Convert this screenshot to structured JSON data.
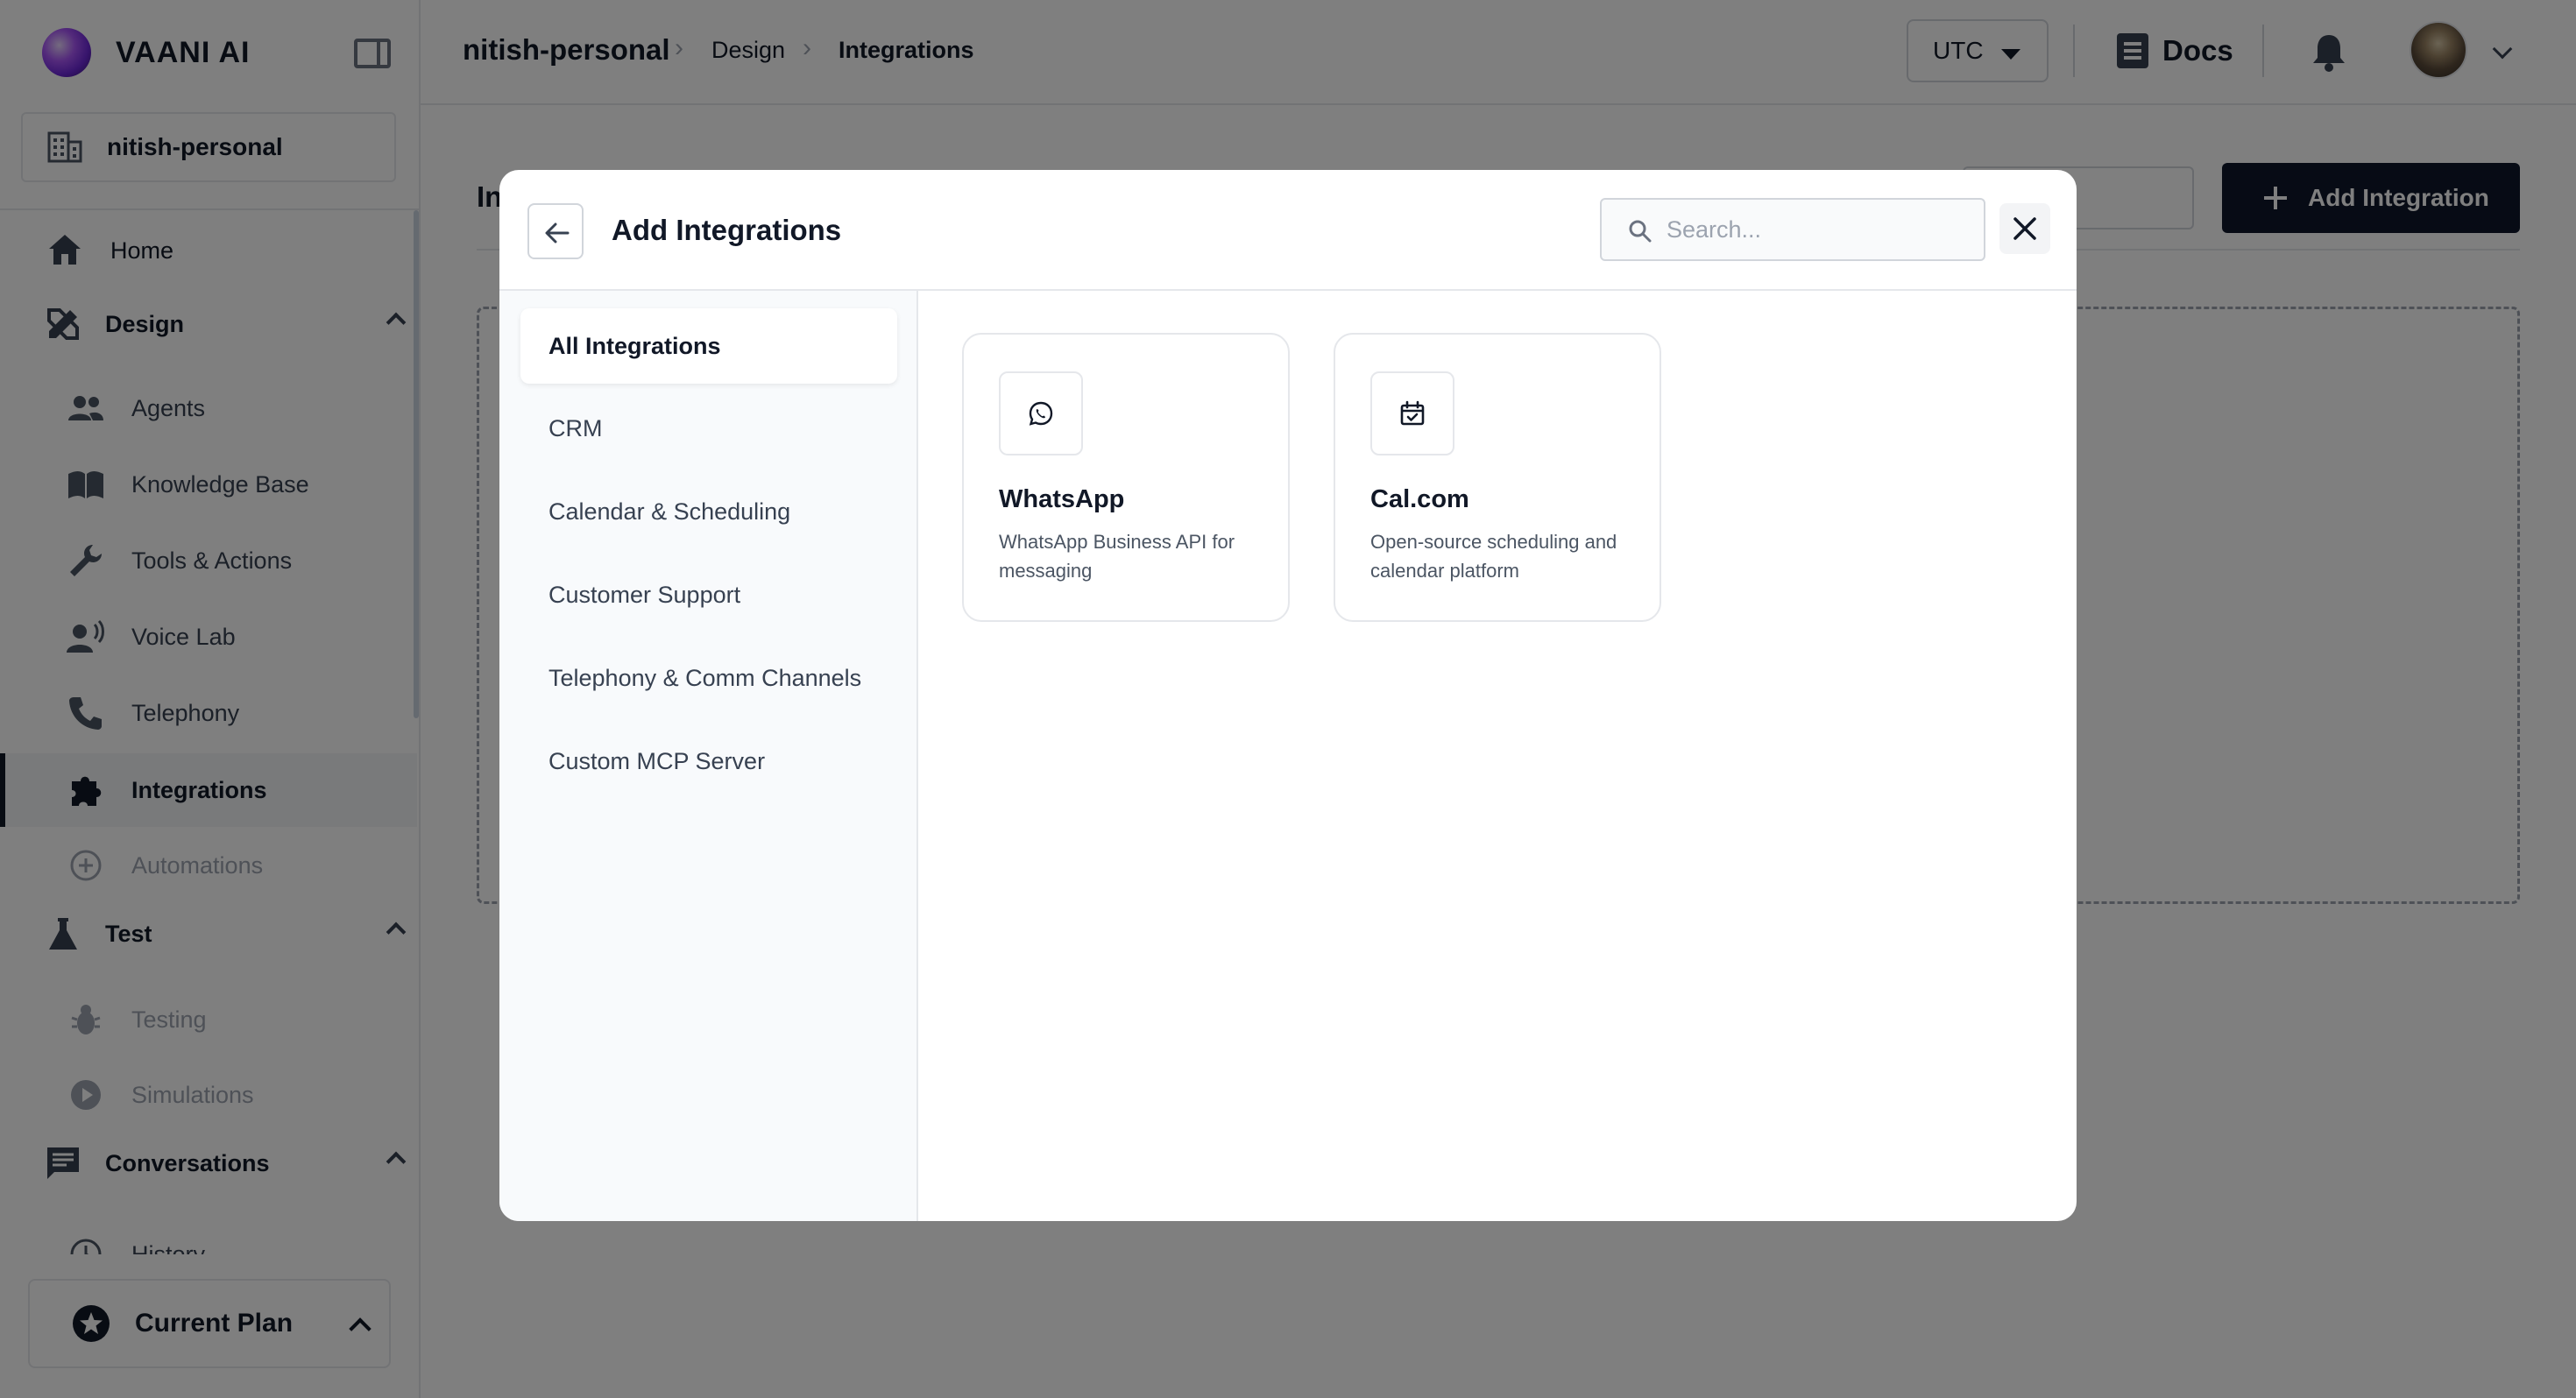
{
  "brand": {
    "name": "VAANI AI"
  },
  "org": {
    "name": "nitish-personal"
  },
  "sidebar": {
    "items": [
      {
        "label": "Home",
        "icon": "home-icon"
      },
      {
        "label": "Design",
        "icon": "design-tools-icon",
        "section": true,
        "expanded": true
      },
      {
        "label": "Agents",
        "icon": "people-icon"
      },
      {
        "label": "Knowledge Base",
        "icon": "book-icon"
      },
      {
        "label": "Tools & Actions",
        "icon": "wrench-icon"
      },
      {
        "label": "Voice Lab",
        "icon": "voice-icon"
      },
      {
        "label": "Telephony",
        "icon": "phone-icon"
      },
      {
        "label": "Integrations",
        "icon": "puzzle-icon",
        "active": true
      },
      {
        "label": "Automations",
        "icon": "automation-icon",
        "disabled": true
      },
      {
        "label": "Test",
        "icon": "flask-icon",
        "section": true,
        "expanded": true
      },
      {
        "label": "Testing",
        "icon": "bug-icon",
        "disabled": true
      },
      {
        "label": "Simulations",
        "icon": "play-circle-icon",
        "disabled": true
      },
      {
        "label": "Conversations",
        "icon": "chat-icon",
        "section": true,
        "expanded": true
      },
      {
        "label": "History",
        "icon": "history-icon"
      }
    ],
    "plan_label": "Current Plan"
  },
  "topbar": {
    "breadcrumb": [
      "nitish-personal",
      "Design",
      "Integrations"
    ],
    "timezone": "UTC",
    "docs_label": "Docs"
  },
  "page": {
    "title_partial": "In",
    "add_button_label": "Add Integration"
  },
  "modal": {
    "title": "Add Integrations",
    "search_placeholder": "Search...",
    "categories": [
      {
        "label": "All Integrations",
        "active": true
      },
      {
        "label": "CRM"
      },
      {
        "label": "Calendar & Scheduling"
      },
      {
        "label": "Customer Support"
      },
      {
        "label": "Telephony & Comm Channels"
      },
      {
        "label": "Custom MCP Server"
      }
    ],
    "integrations": [
      {
        "name": "WhatsApp",
        "description": "WhatsApp Business API for messaging",
        "icon": "whatsapp-icon"
      },
      {
        "name": "Cal.com",
        "description": "Open-source scheduling and calendar platform",
        "icon": "calendar-check-icon"
      }
    ]
  },
  "colors": {
    "primary_button": "#0f172a",
    "overlay": "rgba(0,0,0,0.5)",
    "active_nav_bg": "#f3f4f6"
  }
}
